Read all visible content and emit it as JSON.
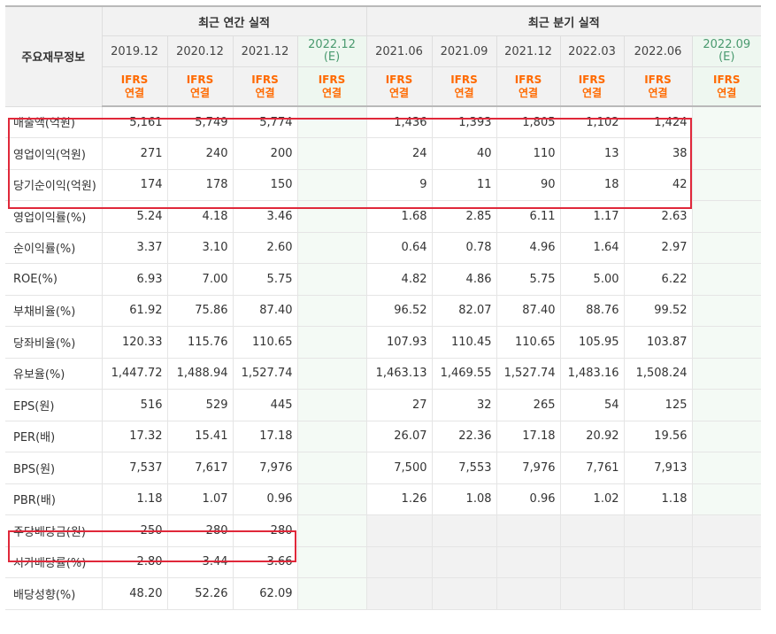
{
  "header": {
    "corner_label": "주요재무정보",
    "annual_group": "최근 연간 실적",
    "quarter_group": "최근 분기 실적",
    "ifrs_line1": "IFRS",
    "ifrs_line2": "연결",
    "annual_periods": [
      {
        "label": "2019.12",
        "estimate": ""
      },
      {
        "label": "2020.12",
        "estimate": ""
      },
      {
        "label": "2021.12",
        "estimate": ""
      },
      {
        "label": "2022.12",
        "estimate": "(E)"
      }
    ],
    "quarter_periods": [
      {
        "label": "2021.06",
        "estimate": ""
      },
      {
        "label": "2021.09",
        "estimate": ""
      },
      {
        "label": "2021.12",
        "estimate": ""
      },
      {
        "label": "2022.03",
        "estimate": ""
      },
      {
        "label": "2022.06",
        "estimate": ""
      },
      {
        "label": "2022.09",
        "estimate": "(E)"
      }
    ]
  },
  "rows": [
    {
      "label": "매출액(억원)",
      "annual": [
        "5,161",
        "5,749",
        "5,774",
        ""
      ],
      "quarter": [
        "1,436",
        "1,393",
        "1,805",
        "1,102",
        "1,424",
        ""
      ]
    },
    {
      "label": "영업이익(억원)",
      "annual": [
        "271",
        "240",
        "200",
        ""
      ],
      "quarter": [
        "24",
        "40",
        "110",
        "13",
        "38",
        ""
      ]
    },
    {
      "label": "당기순이익(억원)",
      "annual": [
        "174",
        "178",
        "150",
        ""
      ],
      "quarter": [
        "9",
        "11",
        "90",
        "18",
        "42",
        ""
      ]
    },
    {
      "label": "영업이익률(%)",
      "annual": [
        "5.24",
        "4.18",
        "3.46",
        ""
      ],
      "quarter": [
        "1.68",
        "2.85",
        "6.11",
        "1.17",
        "2.63",
        ""
      ]
    },
    {
      "label": "순이익률(%)",
      "annual": [
        "3.37",
        "3.10",
        "2.60",
        ""
      ],
      "quarter": [
        "0.64",
        "0.78",
        "4.96",
        "1.64",
        "2.97",
        ""
      ]
    },
    {
      "label": "ROE(%)",
      "annual": [
        "6.93",
        "7.00",
        "5.75",
        ""
      ],
      "quarter": [
        "4.82",
        "4.86",
        "5.75",
        "5.00",
        "6.22",
        ""
      ]
    },
    {
      "label": "부채비율(%)",
      "annual": [
        "61.92",
        "75.86",
        "87.40",
        ""
      ],
      "quarter": [
        "96.52",
        "82.07",
        "87.40",
        "88.76",
        "99.52",
        ""
      ]
    },
    {
      "label": "당좌비율(%)",
      "annual": [
        "120.33",
        "115.76",
        "110.65",
        ""
      ],
      "quarter": [
        "107.93",
        "110.45",
        "110.65",
        "105.95",
        "103.87",
        ""
      ]
    },
    {
      "label": "유보율(%)",
      "annual": [
        "1,447.72",
        "1,488.94",
        "1,527.74",
        ""
      ],
      "quarter": [
        "1,463.13",
        "1,469.55",
        "1,527.74",
        "1,483.16",
        "1,508.24",
        ""
      ]
    },
    {
      "label": "EPS(원)",
      "annual": [
        "516",
        "529",
        "445",
        ""
      ],
      "quarter": [
        "27",
        "32",
        "265",
        "54",
        "125",
        ""
      ]
    },
    {
      "label": "PER(배)",
      "annual": [
        "17.32",
        "15.41",
        "17.18",
        ""
      ],
      "quarter": [
        "26.07",
        "22.36",
        "17.18",
        "20.92",
        "19.56",
        ""
      ]
    },
    {
      "label": "BPS(원)",
      "annual": [
        "7,537",
        "7,617",
        "7,976",
        ""
      ],
      "quarter": [
        "7,500",
        "7,553",
        "7,976",
        "7,761",
        "7,913",
        ""
      ]
    },
    {
      "label": "PBR(배)",
      "annual": [
        "1.18",
        "1.07",
        "0.96",
        ""
      ],
      "quarter": [
        "1.26",
        "1.08",
        "0.96",
        "1.02",
        "1.18",
        ""
      ]
    },
    {
      "label": "주당배당금(원)",
      "annual": [
        "250",
        "280",
        "280",
        ""
      ],
      "quarter": [],
      "dividend": true
    },
    {
      "label": "시가배당률(%)",
      "annual": [
        "2.80",
        "3.44",
        "3.66",
        ""
      ],
      "quarter": [],
      "dividend": true
    },
    {
      "label": "배당성향(%)",
      "annual": [
        "48.20",
        "52.26",
        "62.09",
        ""
      ],
      "quarter": [],
      "dividend": true
    }
  ],
  "colors": {
    "ifrs_orange": "#ff6a00",
    "estimate_green": "#4a9a6f",
    "highlight_red": "#e0283a",
    "header_gray": "#f2f2f2"
  }
}
